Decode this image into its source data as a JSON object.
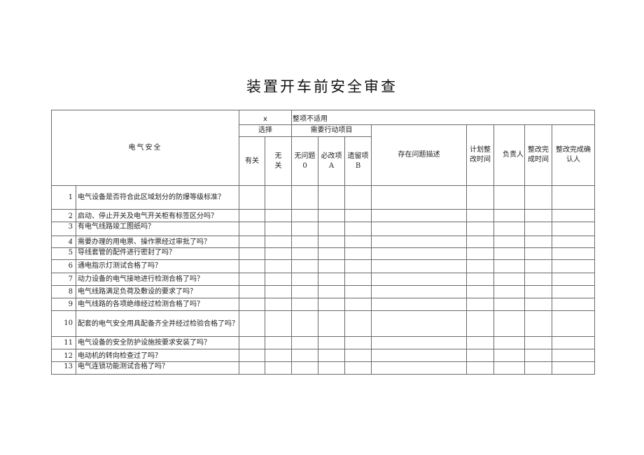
{
  "document": {
    "title": "装置开车前安全审查",
    "section_title": "电气安全"
  },
  "header": {
    "x_mark": "x",
    "not_applicable": "整项不适用",
    "choice_group": "选择",
    "action_group": "需要行动项目",
    "col_relevant": "有关",
    "col_irrelevant_line1": "无",
    "col_irrelevant_line2": "关",
    "col_no_issue_line1": "无问题",
    "col_no_issue_line2": "0",
    "col_must_fix_line1": "必改项",
    "col_must_fix_line2": "A",
    "col_remaining_line1": "遗留项",
    "col_remaining_line2": "B",
    "col_issue_desc": "存在问题描述",
    "col_plan_time_line1": "计划整",
    "col_plan_time_line2": "改时间",
    "col_owner": "负责人",
    "col_done_time_line1": "整改完",
    "col_done_time_line2": "成时间",
    "col_confirm_line1": "整改完成确",
    "col_confirm_line2": "认人"
  },
  "rows": [
    {
      "no": "1",
      "question": "电气设备是否符合此区域划分的防爆等级标准？"
    },
    {
      "no": "2",
      "question": "启动、停止开关及电气开关柜有标签区分吗？"
    },
    {
      "no": "3",
      "question": "有电气线路竣工图纸吗？"
    },
    {
      "no": "4",
      "question": "需要办理的用电票、操作票经过审批了吗？"
    },
    {
      "no": "5",
      "question": "导线套管的配件进行密封了吗？"
    },
    {
      "no": "6",
      "question": "通电指示灯测试合格了吗？"
    },
    {
      "no": "7",
      "question": "动力设备的电气接地进行检测合格了吗？"
    },
    {
      "no": "8",
      "question": "电气线路满足负荷及敷设的要求了吗？"
    },
    {
      "no": "9",
      "question": "电气线路的各项绝缘经过检测合格了吗？"
    },
    {
      "no": "10",
      "question": "配套的电气安全用具配备齐全并经过检验合格了吗？"
    },
    {
      "no": "11",
      "question": "电气设备的安全防护设施按要求安装了吗？"
    },
    {
      "no": "12",
      "question": "电动机的转向检查过了吗？"
    },
    {
      "no": "13",
      "question": "电气连锁功能测试合格了吗？"
    }
  ]
}
